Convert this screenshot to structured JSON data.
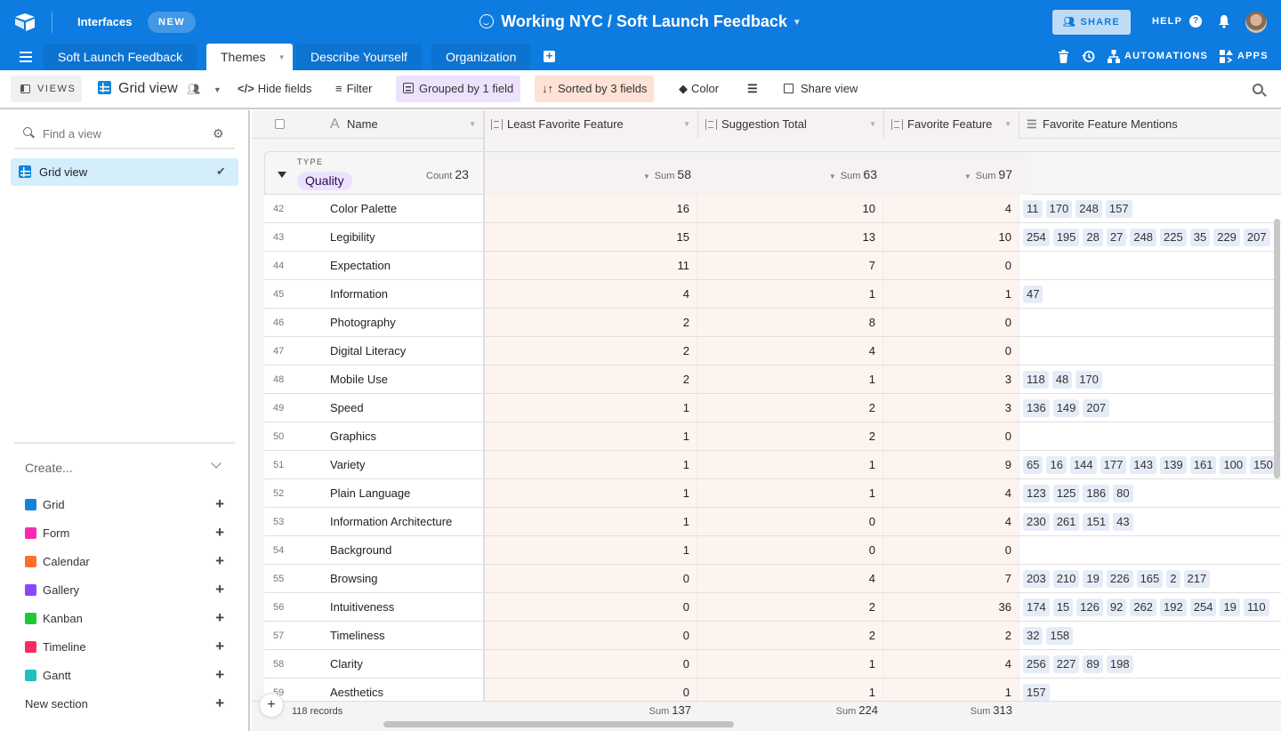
{
  "app": {
    "interfaces_label": "Interfaces",
    "new_badge": "NEW",
    "base_title": "Working NYC / Soft Launch Feedback",
    "share_label": "SHARE",
    "help_label": "HELP",
    "help_icon": "?",
    "accent_color": "#0d7bdf"
  },
  "tabs": [
    {
      "label": "Soft Launch Feedback"
    },
    {
      "label": "Themes",
      "active": true
    },
    {
      "label": "Describe Yourself"
    },
    {
      "label": "Organization"
    }
  ],
  "right_actions": {
    "automations": "AUTOMATIONS",
    "apps": "APPS"
  },
  "toolbar": {
    "views": "VIEWS",
    "view_name": "Grid view",
    "hide_fields": "Hide fields",
    "filter": "Filter",
    "grouped": "Grouped by 1 field",
    "sorted": "Sorted by 3 fields",
    "color": "Color",
    "share_view": "Share view"
  },
  "sidebar": {
    "find_placeholder": "Find a view",
    "views": [
      {
        "label": "Grid view",
        "selected": true
      }
    ],
    "create_label": "Create...",
    "create_items": [
      {
        "label": "Grid",
        "color": "#1283da"
      },
      {
        "label": "Form",
        "color": "#f82bb1"
      },
      {
        "label": "Calendar",
        "color": "#ff6f2c"
      },
      {
        "label": "Gallery",
        "color": "#8b46ff"
      },
      {
        "label": "Kanban",
        "color": "#20c933"
      },
      {
        "label": "Timeline",
        "color": "#f82b60"
      },
      {
        "label": "Gantt",
        "color": "#20c1bd"
      }
    ],
    "new_section": "New section"
  },
  "grid": {
    "columns": {
      "name": "Name",
      "least": "Least Favorite Feature",
      "suggestion": "Suggestion Total",
      "favorite": "Favorite Feature",
      "mentions": "Favorite Feature Mentions"
    },
    "group": {
      "field_label": "TYPE",
      "value": "Quality",
      "count_label": "Count",
      "count": "23",
      "sum_label": "Sum",
      "least_sum": "58",
      "suggestion_sum": "63",
      "favorite_sum": "97"
    },
    "rows": [
      {
        "num": "42",
        "name": "Color Palette",
        "least": "16",
        "suggestion": "10",
        "favorite": "4",
        "mentions": [
          "11",
          "170",
          "248",
          "157"
        ]
      },
      {
        "num": "43",
        "name": "Legibility",
        "least": "15",
        "suggestion": "13",
        "favorite": "10",
        "mentions": [
          "254",
          "195",
          "28",
          "27",
          "248",
          "225",
          "35",
          "229",
          "207"
        ]
      },
      {
        "num": "44",
        "name": "Expectation",
        "least": "11",
        "suggestion": "7",
        "favorite": "0",
        "mentions": []
      },
      {
        "num": "45",
        "name": "Information",
        "least": "4",
        "suggestion": "1",
        "favorite": "1",
        "mentions": [
          "47"
        ]
      },
      {
        "num": "46",
        "name": "Photography",
        "least": "2",
        "suggestion": "8",
        "favorite": "0",
        "mentions": []
      },
      {
        "num": "47",
        "name": "Digital Literacy",
        "least": "2",
        "suggestion": "4",
        "favorite": "0",
        "mentions": []
      },
      {
        "num": "48",
        "name": "Mobile Use",
        "least": "2",
        "suggestion": "1",
        "favorite": "3",
        "mentions": [
          "118",
          "48",
          "170"
        ]
      },
      {
        "num": "49",
        "name": "Speed",
        "least": "1",
        "suggestion": "2",
        "favorite": "3",
        "mentions": [
          "136",
          "149",
          "207"
        ]
      },
      {
        "num": "50",
        "name": "Graphics",
        "least": "1",
        "suggestion": "2",
        "favorite": "0",
        "mentions": []
      },
      {
        "num": "51",
        "name": "Variety",
        "least": "1",
        "suggestion": "1",
        "favorite": "9",
        "mentions": [
          "65",
          "16",
          "144",
          "177",
          "143",
          "139",
          "161",
          "100",
          "150"
        ]
      },
      {
        "num": "52",
        "name": "Plain Language",
        "least": "1",
        "suggestion": "1",
        "favorite": "4",
        "mentions": [
          "123",
          "125",
          "186",
          "80"
        ]
      },
      {
        "num": "53",
        "name": "Information Architecture",
        "least": "1",
        "suggestion": "0",
        "favorite": "4",
        "mentions": [
          "230",
          "261",
          "151",
          "43"
        ]
      },
      {
        "num": "54",
        "name": "Background",
        "least": "1",
        "suggestion": "0",
        "favorite": "0",
        "mentions": []
      },
      {
        "num": "55",
        "name": "Browsing",
        "least": "0",
        "suggestion": "4",
        "favorite": "7",
        "mentions": [
          "203",
          "210",
          "19",
          "226",
          "165",
          "2",
          "217"
        ]
      },
      {
        "num": "56",
        "name": "Intuitiveness",
        "least": "0",
        "suggestion": "2",
        "favorite": "36",
        "mentions": [
          "174",
          "15",
          "126",
          "92",
          "262",
          "192",
          "254",
          "19",
          "110"
        ]
      },
      {
        "num": "57",
        "name": "Timeliness",
        "least": "0",
        "suggestion": "2",
        "favorite": "2",
        "mentions": [
          "32",
          "158"
        ]
      },
      {
        "num": "58",
        "name": "Clarity",
        "least": "0",
        "suggestion": "1",
        "favorite": "4",
        "mentions": [
          "256",
          "227",
          "89",
          "198"
        ]
      },
      {
        "num": "59",
        "name": "Aesthetics",
        "least": "0",
        "suggestion": "1",
        "favorite": "1",
        "mentions": [
          "157"
        ]
      }
    ],
    "footer": {
      "records": "118 records",
      "sum_label": "Sum",
      "least_total": "137",
      "suggestion_total": "224",
      "favorite_total": "313"
    }
  }
}
